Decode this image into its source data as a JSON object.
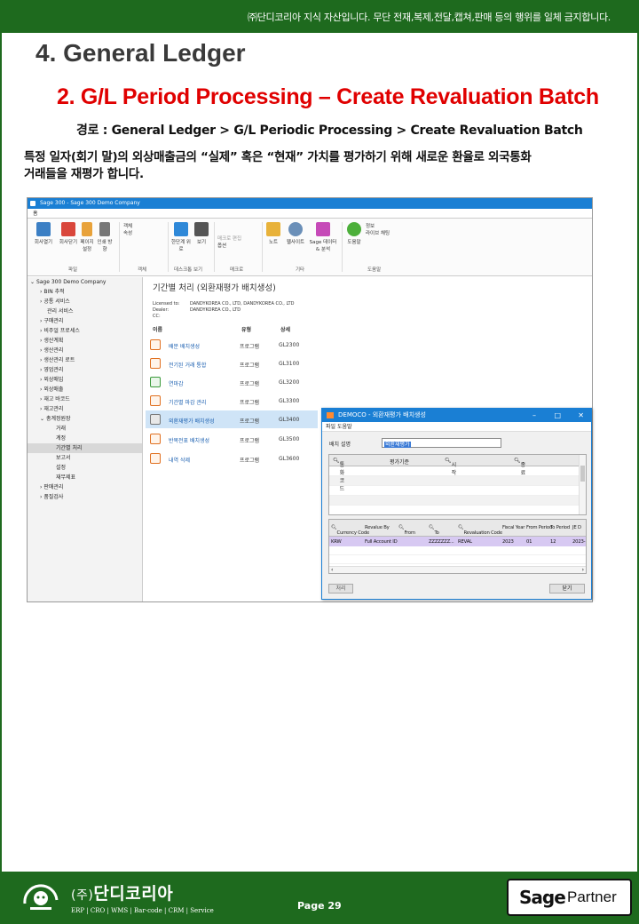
{
  "header": {
    "notice": "㈜단디코리아 지식 자산입니다. 무단 전재,복제,전달,캡쳐,판매  등의 행위를 일체 금지합니다."
  },
  "doc": {
    "chapter": "4. General Ledger",
    "section": "2. G/L Period Processing – Create Revaluation Batch",
    "path": "경로 : General Ledger > G/L Periodic Processing > Create Revaluation Batch",
    "desc_line1": "특정 일자(회기 말)의 외상매출금의 “실제” 혹은 “현재” 가치를 평가하기 위해 새로운 환율로 외국통화",
    "desc_line2": "거래들을 재평가 합니다."
  },
  "sage": {
    "title": "Sage 300 - Sage 300 Demo Company",
    "tab": "홈",
    "ribbon": {
      "buttons": [
        "회사열기",
        "회사닫기",
        "페이지 설정",
        "인쇄 방향",
        "객체",
        "속성",
        "한단계 위로",
        "보기",
        "매크로 편집",
        "옵션",
        "노트",
        "웹사이트",
        "Sage 데이터 & 분석",
        "도움말",
        "정보",
        "라이브 채팅"
      ],
      "groups": [
        "파일",
        "객체",
        "데스크톱 보기",
        "매크로",
        "기타",
        "도움말"
      ]
    },
    "tree": [
      "Sage 300 Demo Company",
      "BIN 추적",
      "공통 서비스",
      "관리 서비스",
      "구매관리",
      "비주얼 프로세스",
      "생산계획",
      "생산관리",
      "생산관리 로트",
      "영업관리",
      "외상매입",
      "외상매출",
      "재고 바코드",
      "재고관리",
      "총계정원장",
      "거래",
      "계정",
      "기간별 처리",
      "보고서",
      "설정",
      "재무제표",
      "판매관리",
      "품질검사"
    ],
    "content": {
      "title": "기간별 처리 (외환재평가 배치생성)",
      "licensed_to_label": "Licensed to:",
      "licensed_to": "DANDYKOREA CO., LTD, DANDYKOREA CO., LTD",
      "dealer_label": "Dealer:",
      "dealer": "DANDYKOREA CO., LTD",
      "cc_label": "CC:",
      "col_name": "이름",
      "col_type": "유형",
      "col_detail": "상세",
      "rows": [
        {
          "name": "배분 배치생성",
          "type": "프로그램",
          "code": "GL2300"
        },
        {
          "name": "전기된 거래 통합",
          "type": "프로그램",
          "code": "GL3100"
        },
        {
          "name": "연마감",
          "type": "프로그램",
          "code": "GL3200"
        },
        {
          "name": "기간별 마감 관리",
          "type": "프로그램",
          "code": "GL3300"
        },
        {
          "name": "외환재평가 배치생성",
          "type": "프로그램",
          "code": "GL3400"
        },
        {
          "name": "반복전표 배치생성",
          "type": "프로그램",
          "code": "GL3500"
        },
        {
          "name": "내역 삭제",
          "type": "프로그램",
          "code": "GL3600"
        }
      ]
    }
  },
  "dialog": {
    "title": "DEMOCO - 외환재평가 배치생성",
    "menu": "파일  도움말",
    "batch_label": "배치 설명",
    "batch_value": "외환재평가",
    "grid1_headers": [
      "통화 코드",
      "평가기준",
      "시작",
      "종료"
    ],
    "grid2_headers": [
      "Currency Code",
      "Revalue By",
      "From",
      "To",
      "Revaluation Code",
      "Fiscal Year",
      "From Period",
      "To Period",
      "JE D"
    ],
    "grid2_row": [
      "KRW",
      "Full Account ID",
      "",
      "ZZZZZZZ...",
      "REVAL",
      "2023",
      "01",
      "12",
      "2023-"
    ],
    "btn_process": "처리",
    "btn_close": "닫기"
  },
  "footer": {
    "company_prefix": "(주)",
    "company": "단디코리아",
    "sub": "ERP | CRO | WMS | Bar-code | CRM | Service",
    "page": "Page 29",
    "badge_sage": "Sage",
    "badge_partner": "Partner"
  }
}
